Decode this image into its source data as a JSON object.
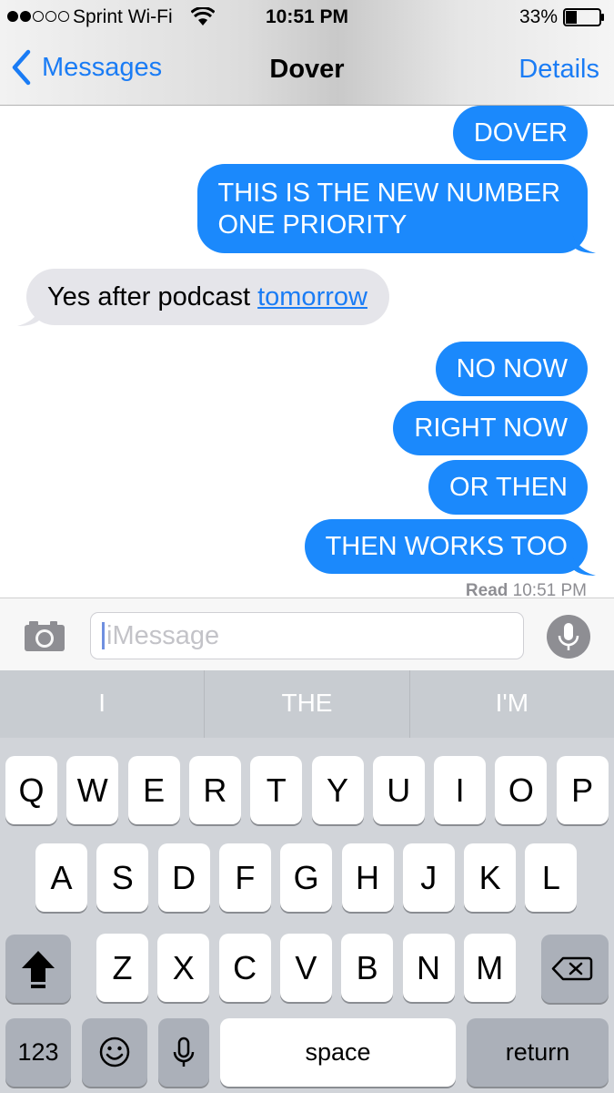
{
  "status_bar": {
    "signal_bars": 2,
    "signal_total": 5,
    "carrier": "Sprint Wi-Fi",
    "time": "10:51 PM",
    "battery_percent": "33%",
    "battery_level": 0.33
  },
  "nav": {
    "back_label": "Messages",
    "title": "Dover",
    "details_label": "Details"
  },
  "messages": [
    {
      "direction": "outgoing",
      "lines": [
        "DOVER"
      ]
    },
    {
      "direction": "outgoing",
      "lines": [
        "THIS IS THE NEW NUMBER",
        "ONE PRIORITY"
      ]
    },
    {
      "direction": "incoming",
      "text": "Yes after podcast ",
      "link": "tomorrow"
    },
    {
      "direction": "outgoing",
      "lines": [
        "NO NOW"
      ]
    },
    {
      "direction": "outgoing",
      "lines": [
        "RIGHT NOW"
      ]
    },
    {
      "direction": "outgoing",
      "lines": [
        "OR THEN"
      ]
    },
    {
      "direction": "outgoing",
      "lines": [
        "THEN WORKS TOO"
      ]
    }
  ],
  "read_receipt": {
    "label": "Read",
    "time": "10:51 PM"
  },
  "input": {
    "placeholder": "iMessage"
  },
  "predictions": [
    "I",
    "THE",
    "I'M"
  ],
  "keyboard": {
    "row1": [
      "Q",
      "W",
      "E",
      "R",
      "T",
      "Y",
      "U",
      "I",
      "O",
      "P"
    ],
    "row2": [
      "A",
      "S",
      "D",
      "F",
      "G",
      "H",
      "J",
      "K",
      "L"
    ],
    "row3": [
      "Z",
      "X",
      "C",
      "V",
      "B",
      "N",
      "M"
    ],
    "numbers_label": "123",
    "space_label": "space",
    "return_label": "return"
  },
  "colors": {
    "accent": "#1a7cf5",
    "outgoing_bubble": "#1b89fc",
    "incoming_bubble": "#e5e5ea"
  },
  "icons": [
    "wifi-icon",
    "battery-icon",
    "chevron-left-icon",
    "camera-icon",
    "microphone-icon",
    "shift-icon",
    "delete-icon",
    "emoji-icon",
    "keyboard-microphone-icon"
  ]
}
